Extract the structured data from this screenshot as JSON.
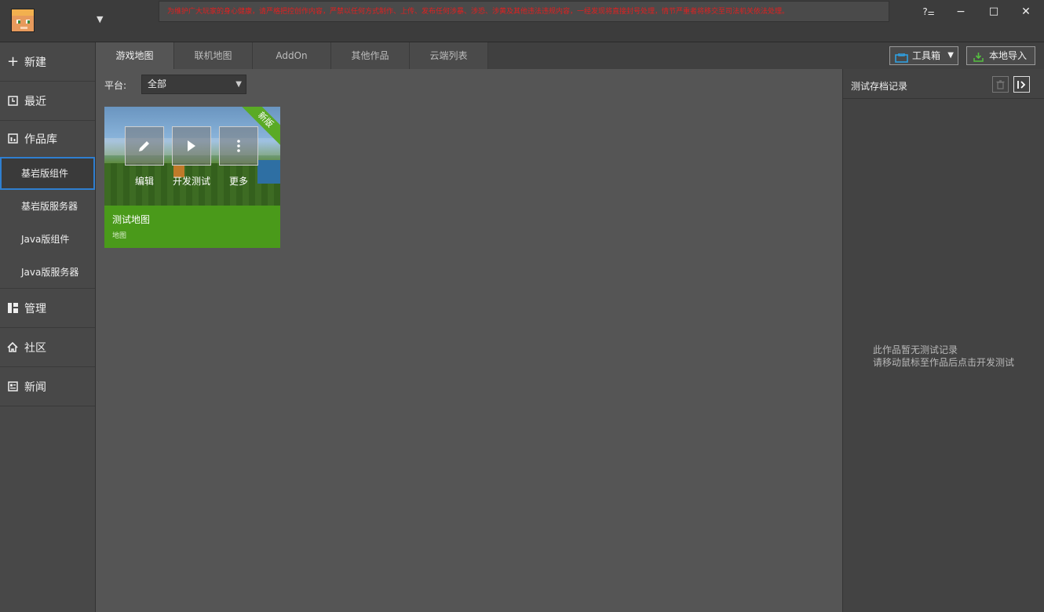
{
  "titlebar": {
    "notice": "为维护广大玩家的身心健康，请严格把控创作内容，严禁以任何方式制作、上传、发布任何涉暴、涉恐、涉黄及其他违法违规内容，一经发现将直接封号处理，情节严重者将移交至司法机关依法处理。",
    "help": "?",
    "minimize": "−",
    "maximize": "□",
    "close": "✕"
  },
  "sidebar": {
    "new": "新建",
    "recent": "最近",
    "library": "作品库",
    "bedrock_addon": "基岩版组件",
    "bedrock_server": "基岩版服务器",
    "java_addon": "Java版组件",
    "java_server": "Java版服务器",
    "manage": "管理",
    "community": "社区",
    "news": "新闻"
  },
  "tabs": [
    "游戏地图",
    "联机地图",
    "AddOn",
    "其他作品",
    "云端列表"
  ],
  "toolbar": {
    "toolbox": "工具箱",
    "local_import": "本地导入"
  },
  "filter": {
    "platform_label": "平台:",
    "platform_value": "全部"
  },
  "card": {
    "badge": "新版",
    "edit": "编辑",
    "dev_test": "开发测试",
    "more": "更多",
    "title": "测试地图",
    "type": "地图"
  },
  "right_panel": {
    "title": "测试存档记录",
    "empty_line1": "此作品暂无测试记录",
    "empty_line2": "请移动鼠标至作品后点击开发测试"
  },
  "colors": {
    "accent_blue": "#2f7fd0",
    "card_green": "#4a9a1a",
    "notice_red": "#e02020"
  }
}
